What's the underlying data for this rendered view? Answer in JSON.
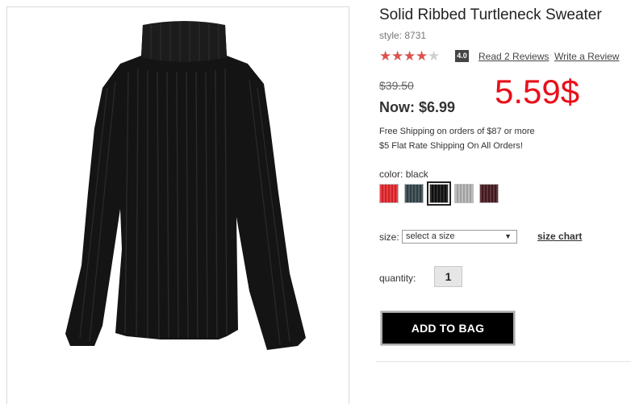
{
  "product": {
    "title": "Solid Ribbed Turtleneck Sweater",
    "style": "style: 8731",
    "image_alt": "black ribbed turtleneck sweater"
  },
  "rating": {
    "stars_filled": 4,
    "stars_total": 5,
    "value": "4.0",
    "read_reviews": "Read 2 Reviews",
    "write_review": "Write a Review",
    "star_color": "#d9534f"
  },
  "pricing": {
    "original": "$39.50",
    "now_label": "Now:",
    "now_price": "$6.99",
    "annotation": "5.59$",
    "annotation_color": "#e8101a"
  },
  "shipping": {
    "line1": "Free Shipping on orders of $87 or more",
    "line2": "$5 Flat Rate Shipping On All Orders!"
  },
  "color": {
    "label": "color:",
    "selected": "black",
    "swatches": [
      {
        "name": "red",
        "hex": "#e8262c"
      },
      {
        "name": "dark teal",
        "hex": "#34474b"
      },
      {
        "name": "black",
        "hex": "#111111",
        "selected": true
      },
      {
        "name": "heather grey",
        "hex": "#b5b5b5"
      },
      {
        "name": "burgundy",
        "hex": "#4a1a22"
      }
    ]
  },
  "size": {
    "label": "size:",
    "selected": "select a size",
    "chart_link": "size chart"
  },
  "quantity": {
    "label": "quantity:",
    "value": "1"
  },
  "actions": {
    "add_to_bag": "ADD TO BAG"
  }
}
